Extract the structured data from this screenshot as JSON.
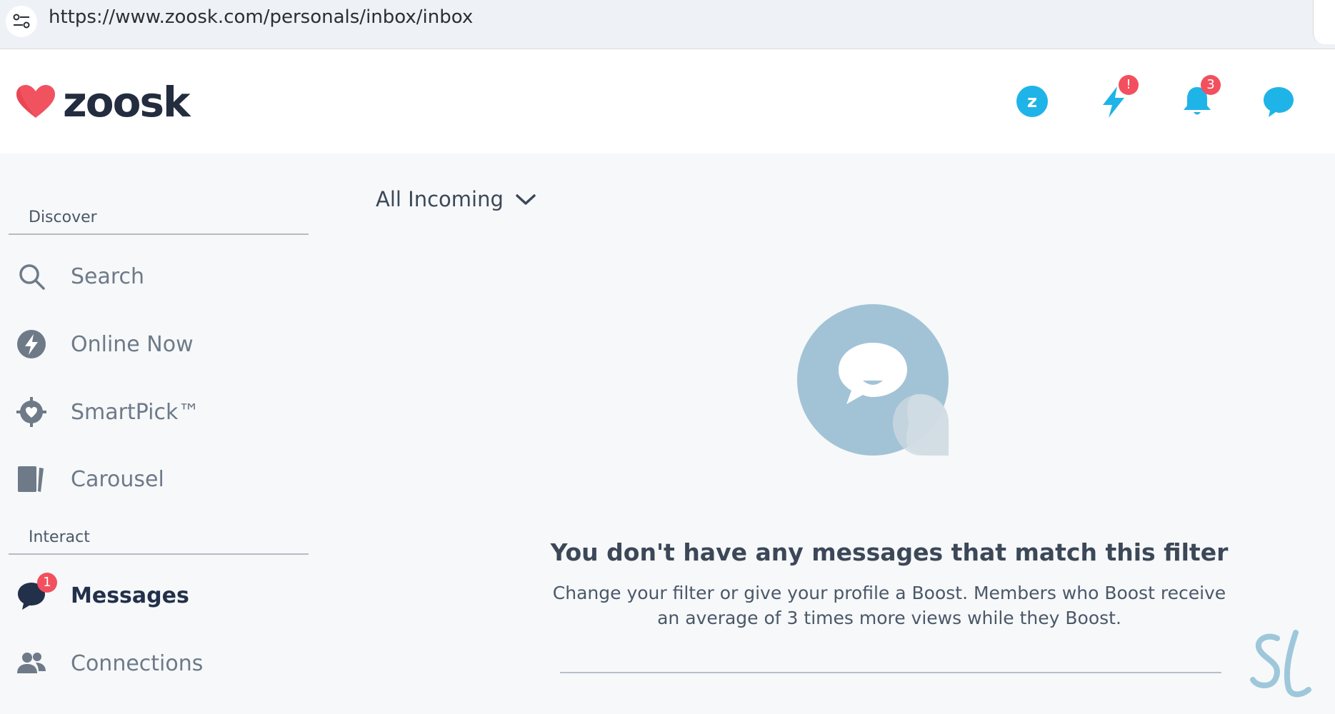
{
  "browser": {
    "url": "https://www.zoosk.com/personals/inbox/inbox"
  },
  "header": {
    "logo_text": "zoosk",
    "lightning_badge": "!",
    "notifications_badge": "3",
    "zoosk_coin_letter": "z"
  },
  "sidebar": {
    "discover_label": "Discover",
    "interact_label": "Interact",
    "discover_items": [
      {
        "label": "Search",
        "icon": "search-icon"
      },
      {
        "label": "Online Now",
        "icon": "lightning-circle-icon"
      },
      {
        "label": "SmartPick™",
        "icon": "smartpick-target-icon"
      },
      {
        "label": "Carousel",
        "icon": "carousel-cards-icon"
      }
    ],
    "interact_items": [
      {
        "label": "Messages",
        "icon": "chat-bubble-icon",
        "badge": "1",
        "active": true
      },
      {
        "label": "Connections",
        "icon": "people-icon"
      }
    ]
  },
  "main": {
    "filter_label": "All Incoming",
    "empty_title": "You don't have any messages that match this filter",
    "empty_description": "Change your filter or give your profile a Boost. Members who Boost receive an average of 3 times more views while they Boost."
  },
  "colors": {
    "brand_red": "#f0525f",
    "accent_blue": "#1fb4e8",
    "badge_red": "#f2505e",
    "text_dark": "#22304a",
    "illustration_blue": "#a2c3d6"
  }
}
